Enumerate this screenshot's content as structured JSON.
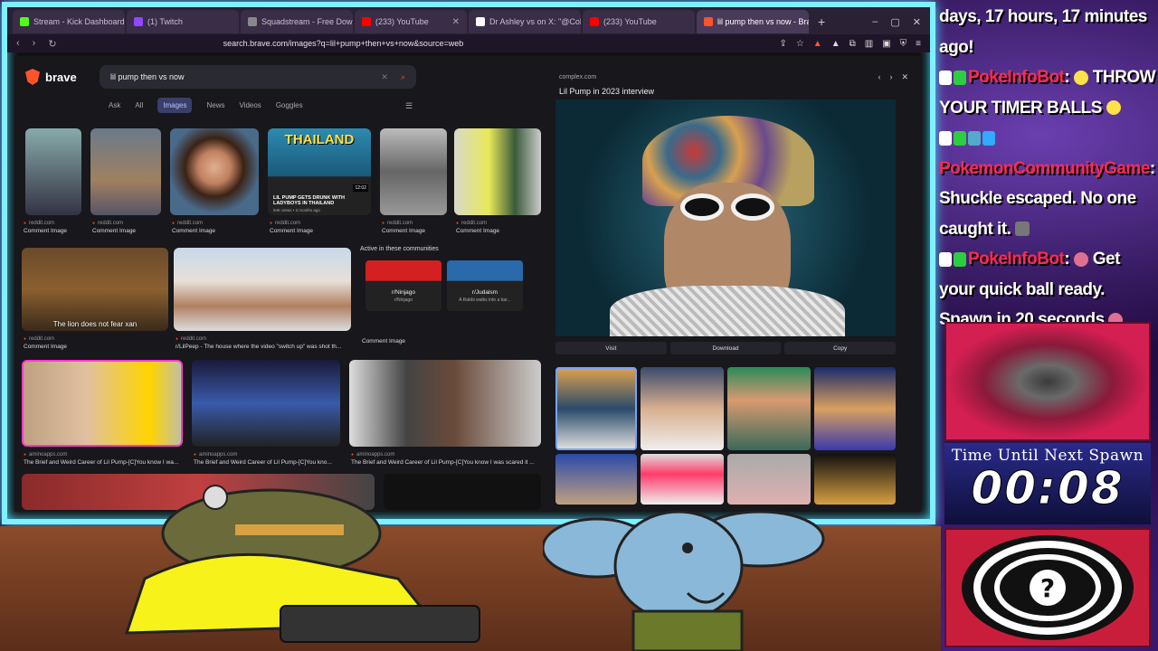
{
  "browser": {
    "tabs": [
      {
        "label": "Stream - Kick Dashboard",
        "color": "#53fc18"
      },
      {
        "label": "(1) Twitch",
        "color": "#9146ff"
      },
      {
        "label": "Squadstream - Free Download, Borrow",
        "color": "#888888"
      },
      {
        "label": "(233) YouTube",
        "color": "#ff0000"
      },
      {
        "label": "Dr Ashley vs on X: \"@CollinRugg Th...",
        "color": "#ffffff"
      },
      {
        "label": "(233) YouTube",
        "color": "#ff0000"
      },
      {
        "label": "lil pump then vs now - Brave Se...",
        "color": "#fb542b",
        "active": true
      }
    ],
    "url": "search.brave.com/images?q=lil+pump+then+vs+now&source=web"
  },
  "search": {
    "logo": "brave",
    "query": "lil pump then vs now",
    "nav": [
      "Ask",
      "All",
      "Images",
      "News",
      "Videos",
      "Goggles"
    ],
    "active_nav": "Images"
  },
  "results": {
    "row1": [
      {
        "src": "reddit.com",
        "title": "Comment Image"
      },
      {
        "src": "reddit.com",
        "title": "Comment Image"
      },
      {
        "src": "reddit.com",
        "title": "Comment Image"
      },
      {
        "src": "reddit.com",
        "title": "Comment Image"
      },
      {
        "src": "reddit.com",
        "title": "Comment Image"
      },
      {
        "src": "reddit.com",
        "title": "Comment Image"
      }
    ],
    "thailand": {
      "headline": "THAILAND",
      "caption": "LIL PUMP GETS DRUNK WITH LADYBOYS IN THAILAND",
      "meta": "94K views • 3 months ago",
      "duration": "12:02"
    },
    "row2": [
      {
        "src": "reddit.com",
        "title": "Comment Image",
        "overlay": "The lion does not fear xan"
      },
      {
        "src": "reddit.com",
        "title": "r/LilPeep - The house where the video \"switch up\" was shot th..."
      },
      {
        "src": "",
        "title": "Comment Image"
      }
    ],
    "communities": {
      "title": "Active in these communities",
      "items": [
        {
          "name": "r/Ninjago",
          "sub": "r/Ninjago"
        },
        {
          "name": "r/Judaism",
          "sub": "A Rabbi walks into a bar..."
        }
      ]
    },
    "row3": [
      {
        "src": "aminoapps.com",
        "title": "The Brief and Weird Career of Lil Pump-[C]You know I wa..."
      },
      {
        "src": "aminoapps.com",
        "title": "The Brief and Weird Career of Lil Pump-[C]You kno..."
      },
      {
        "src": "aminoapps.com",
        "title": "The Brief and Weird Career of Lil Pump-[C]You know I was scared it ..."
      }
    ]
  },
  "detail": {
    "source": "complex.com",
    "title": "Lil Pump in 2023 interview",
    "buttons": {
      "visit": "Visit",
      "download": "Download",
      "copy": "Copy"
    }
  },
  "chat": {
    "line0": "days, 17 hours, 17 minutes ago!",
    "msg1_user": "PokeInfoBot",
    "msg1_text": "THROW YOUR TIMER BALLS",
    "msg2_user": "PokemonCommunityGame",
    "msg2_text": "Shuckle escaped. No one caught it.",
    "msg3_user": "PokeInfoBot",
    "msg3_text": "Get your quick ball ready. Spawn in 20 seconds",
    "colon": ":"
  },
  "spawn": {
    "label": "Time Until Next Spawn",
    "timer": "00:08"
  }
}
